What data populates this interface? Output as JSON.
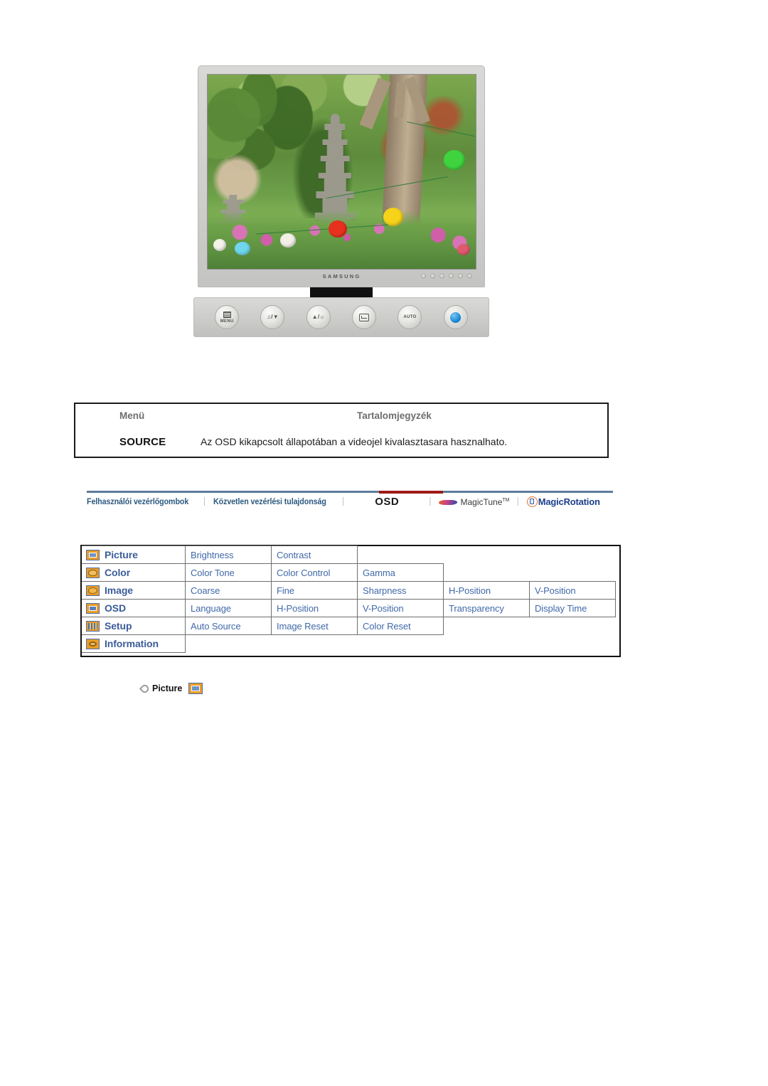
{
  "product_image": {
    "brand_wordmark": "SAMSUNG",
    "buttons": [
      {
        "name": "menu-button",
        "label": "MENU",
        "glyph": "menu-grid-icon"
      },
      {
        "name": "volume-down-button",
        "label": "▼",
        "glyph": "speaker-down-icon"
      },
      {
        "name": "brightness-up-button",
        "label": "▲",
        "glyph": "brightness-up-icon"
      },
      {
        "name": "enter-button",
        "label": "",
        "glyph": "enter-icon"
      },
      {
        "name": "auto-button",
        "label": "AUTO",
        "glyph": "auto-text"
      },
      {
        "name": "power-button",
        "label": "",
        "glyph": "power-icon"
      }
    ],
    "indicator_count": 6
  },
  "source_table": {
    "header": {
      "menu": "Menü",
      "contents": "Tartalomjegyzék"
    },
    "row": {
      "menu": "SOURCE",
      "description": "Az OSD kikapcsolt állapotában a videojel kivalasztasara hasznalhato."
    }
  },
  "nav": {
    "links": [
      "Felhasználói vezérlőgombok",
      "Közvetlen vezérlési tulajdonság"
    ],
    "separator": "│",
    "active": "OSD",
    "magictune": {
      "label": "MagicTune",
      "trademark": "TM",
      "icon": "magictune-swoosh-icon"
    },
    "magicrotation": {
      "label": "MagicRotation",
      "icon": "magicrotation-monitor-icon"
    },
    "accent_color": "#9e1a16",
    "rule_color": "#5d7c9c",
    "link_color": "#2d5a80"
  },
  "osd_map": {
    "menu_color": "#3c5c98",
    "sub_color": "#4169a8",
    "rows": [
      {
        "icon": "picture-icon",
        "menu": "Picture",
        "subs": [
          "Brightness",
          "Contrast"
        ]
      },
      {
        "icon": "color-icon",
        "menu": "Color",
        "subs": [
          "Color Tone",
          "Color Control",
          "Gamma"
        ]
      },
      {
        "icon": "image-icon",
        "menu": "Image",
        "subs": [
          "Coarse",
          "Fine",
          "Sharpness",
          "H-Position",
          "V-Position"
        ]
      },
      {
        "icon": "osd-icon",
        "menu": "OSD",
        "subs": [
          "Language",
          "H-Position",
          "V-Position",
          "Transparency",
          "Display Time"
        ]
      },
      {
        "icon": "setup-icon",
        "menu": "Setup",
        "subs": [
          "Auto Source",
          "Image Reset",
          "Color Reset"
        ]
      },
      {
        "icon": "information-icon",
        "menu": "Information",
        "subs": []
      }
    ]
  },
  "picture_section": {
    "bullet": "diamond-bullet-icon",
    "label": "Picture",
    "icon": "picture-icon"
  }
}
